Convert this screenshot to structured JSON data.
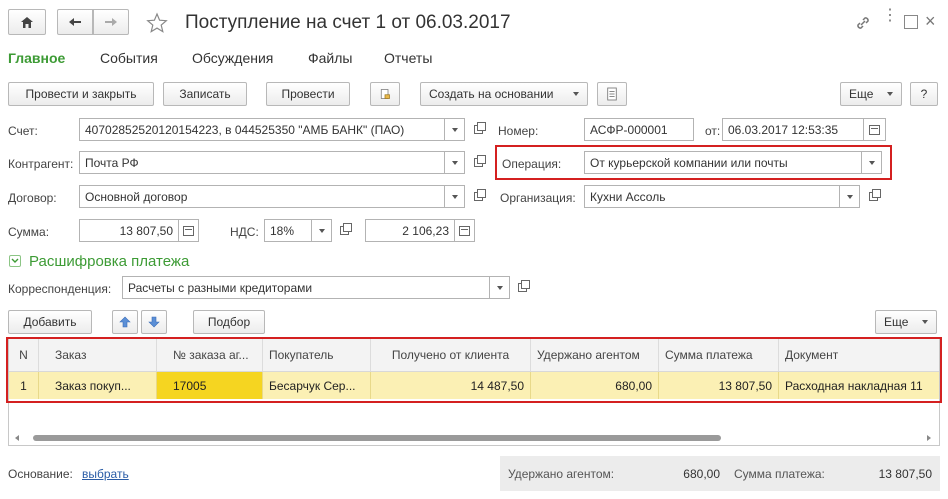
{
  "window": {
    "title": "Поступление на счет 1 от 06.03.2017"
  },
  "tabs": [
    "Главное",
    "События",
    "Обсуждения",
    "Файлы",
    "Отчеты"
  ],
  "toolbar": {
    "post_close": "Провести и закрыть",
    "save": "Записать",
    "post": "Провести",
    "create_based_on": "Создать на основании",
    "more": "Еще",
    "help": "?"
  },
  "form": {
    "account_label": "Счет:",
    "account_value": "40702852520120154223, в 044525350 \"АМБ БАНК\" (ПАО)",
    "number_label": "Номер:",
    "number_value": "АСФР-000001",
    "date_label": "от:",
    "date_value": "06.03.2017 12:53:35",
    "counterparty_label": "Контрагент:",
    "counterparty_value": "Почта РФ",
    "operation_label": "Операция:",
    "operation_value": "От курьерской компании или почты",
    "contract_label": "Договор:",
    "contract_value": "Основной договор",
    "organization_label": "Организация:",
    "organization_value": "Кухни Ассоль",
    "sum_label": "Сумма:",
    "sum_value": "13 807,50",
    "vat_label": "НДС:",
    "vat_rate": "18%",
    "vat_value": "2 106,23"
  },
  "section": {
    "title": "Расшифровка платежа",
    "corr_label": "Корреспонденция:",
    "corr_value": "Расчеты с разными кредиторами"
  },
  "table_toolbar": {
    "add": "Добавить",
    "pick": "Подбор",
    "more": "Еще"
  },
  "table": {
    "columns": [
      "N",
      "Заказ",
      "№ заказа аг...",
      "Покупатель",
      "Получено от клиента",
      "Удержано агентом",
      "Сумма платежа",
      "Документ"
    ],
    "rows": [
      [
        "1",
        "Заказ покуп...",
        "17005",
        "Бесарчук Сер...",
        "14 487,50",
        "680,00",
        "13 807,50",
        "Расходная накладная 11"
      ]
    ]
  },
  "footer": {
    "basis_label": "Основание:",
    "basis_link": "выбрать",
    "withheld_label": "Удержано агентом:",
    "withheld_value": "680,00",
    "payment_label": "Сумма платежа:",
    "payment_value": "13 807,50"
  },
  "colors": {
    "accent_green": "#3d9b35",
    "highlight_red": "#d42020",
    "selected_row": "#fbf0b4",
    "selected_cell": "#f5d521"
  }
}
